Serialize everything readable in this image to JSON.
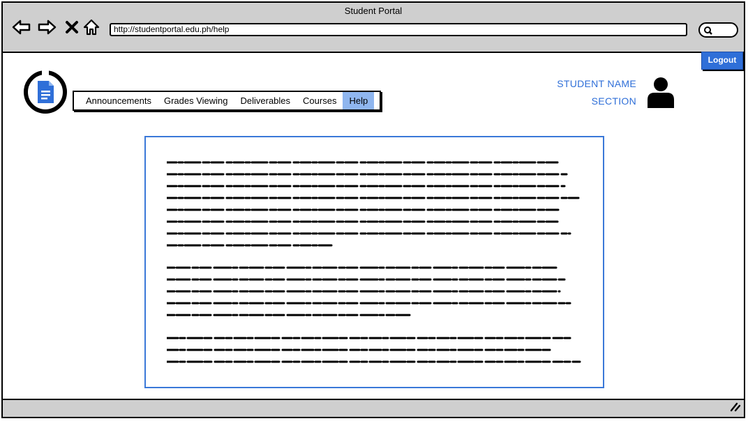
{
  "window": {
    "title": "Student Portal"
  },
  "browser": {
    "url": "http://studentportal.edu.ph/help",
    "icons": {
      "back": "back-arrow-icon",
      "forward": "forward-arrow-icon",
      "stop": "close-x-icon",
      "home": "home-icon",
      "search": "search-icon",
      "resize": "resize-grip-icon"
    }
  },
  "header": {
    "logout_label": "Logout",
    "student_name": "STUDENT NAME",
    "section": "SECTION",
    "logo_icon": "document-icon",
    "avatar_icon": "user-avatar-icon"
  },
  "nav": {
    "items": [
      {
        "label": "Announcements"
      },
      {
        "label": "Grades Viewing"
      },
      {
        "label": "Deliverables"
      },
      {
        "label": "Courses"
      },
      {
        "label": "Help"
      }
    ],
    "active": "Help"
  },
  "colors": {
    "accent": "#2f6fd8",
    "active_tab": "#8fb6ef",
    "chrome": "#cfcfcf",
    "content_border": "#3a78d8"
  }
}
